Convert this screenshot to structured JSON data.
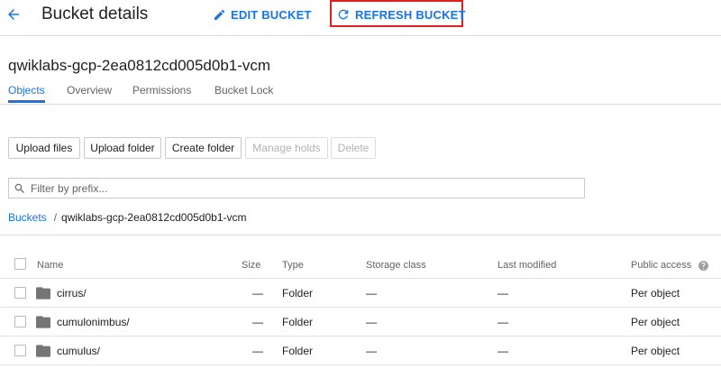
{
  "header": {
    "title": "Bucket details",
    "edit_label": "EDIT BUCKET",
    "refresh_label": "REFRESH BUCKET"
  },
  "bucket": {
    "name": "qwiklabs-gcp-2ea0812cd005d0b1-vcm"
  },
  "tabs": [
    "Objects",
    "Overview",
    "Permissions",
    "Bucket Lock"
  ],
  "toolbar": {
    "upload_files": "Upload files",
    "upload_folder": "Upload folder",
    "create_folder": "Create folder",
    "manage_holds": "Manage holds",
    "delete": "Delete"
  },
  "filter": {
    "placeholder": "Filter by prefix..."
  },
  "breadcrumb": {
    "root": "Buckets",
    "separator": "/",
    "current": "qwiklabs-gcp-2ea0812cd005d0b1-vcm"
  },
  "table": {
    "columns": [
      "Name",
      "Size",
      "Type",
      "Storage class",
      "Last modified",
      "Public access"
    ],
    "rows": [
      {
        "name": "cirrus/",
        "size": "—",
        "type": "Folder",
        "storage_class": "—",
        "last_modified": "—",
        "public_access": "Per object"
      },
      {
        "name": "cumulonimbus/",
        "size": "—",
        "type": "Folder",
        "storage_class": "—",
        "last_modified": "—",
        "public_access": "Per object"
      },
      {
        "name": "cumulus/",
        "size": "—",
        "type": "Folder",
        "storage_class": "—",
        "last_modified": "—",
        "public_access": "Per object"
      }
    ]
  },
  "icons": {
    "back": "arrow-back-icon",
    "edit": "pencil-icon",
    "refresh": "refresh-icon",
    "search": "search-icon",
    "folder": "folder-icon",
    "help": "help-icon"
  },
  "colors": {
    "accent": "#1a73e8",
    "highlight": "#e02020",
    "folder": "#757575"
  }
}
